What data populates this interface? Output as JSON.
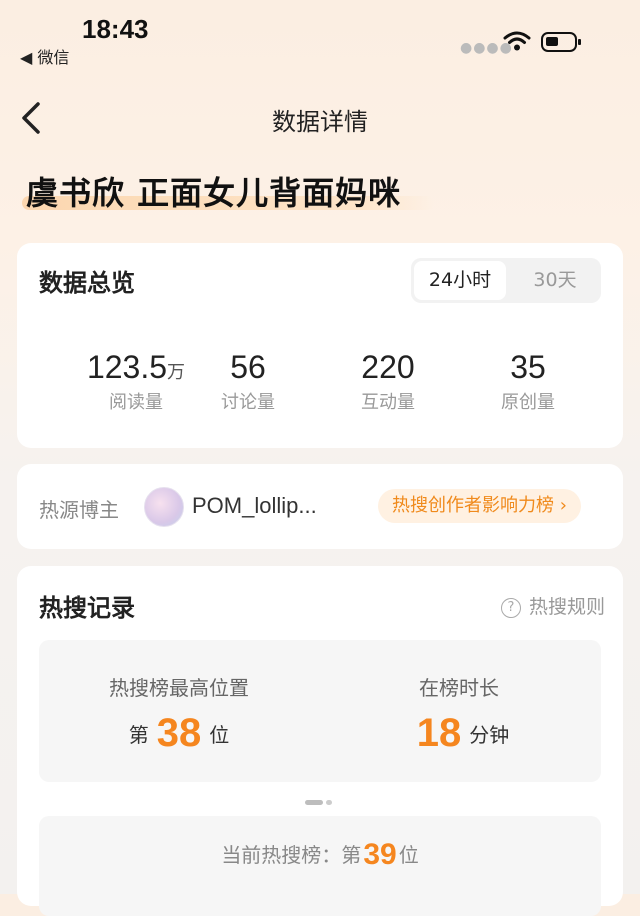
{
  "status_bar": {
    "time": "18:43",
    "back_app": "◀ 微信"
  },
  "header": {
    "title": "数据详情"
  },
  "topic": "虞书欣 正面女儿背面妈咪",
  "overview": {
    "title": "数据总览",
    "segments": [
      "24小时",
      "30天"
    ],
    "selected": "24小时",
    "stats": [
      {
        "value": "123.5",
        "unit": "万",
        "label": "阅读量"
      },
      {
        "value": "56",
        "unit": "",
        "label": "讨论量"
      },
      {
        "value": "220",
        "unit": "",
        "label": "互动量"
      },
      {
        "value": "35",
        "unit": "",
        "label": "原创量"
      }
    ]
  },
  "source": {
    "label": "热源博主",
    "blogger_name": "POM_lollip...",
    "rank_link": "热搜创作者影响力榜 ›"
  },
  "records": {
    "title": "热搜记录",
    "rules": "热搜规则",
    "highest": {
      "label": "热搜榜最高位置",
      "prefix": "第",
      "value": "38",
      "suffix": "位"
    },
    "duration": {
      "label": "在榜时长",
      "value": "18",
      "suffix": "分钟"
    },
    "current": {
      "label": "当前热搜榜：第",
      "value": "39",
      "suffix": "位"
    }
  }
}
